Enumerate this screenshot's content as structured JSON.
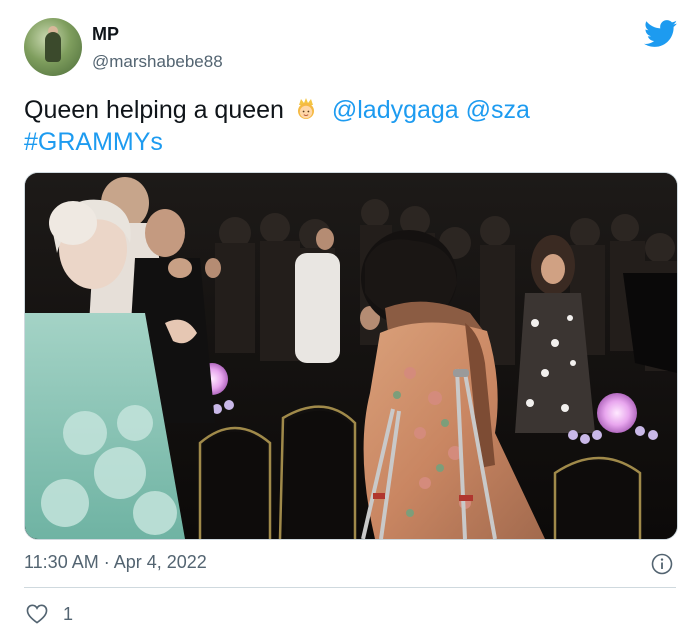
{
  "user": {
    "display_name": "MP",
    "handle": "@marshabebe88"
  },
  "tweet": {
    "text": "Queen helping a queen",
    "emoji": "princess-emoji",
    "mentions": [
      "@ladygaga",
      "@sza"
    ],
    "hashtag": "#GRAMMYs"
  },
  "meta": {
    "timestamp": "11:30 AM · Apr 4, 2022"
  },
  "engagement": {
    "likes": "1"
  },
  "colors": {
    "link": "#1d9bf0",
    "secondary_text": "#536471",
    "border": "#cfd9de"
  }
}
